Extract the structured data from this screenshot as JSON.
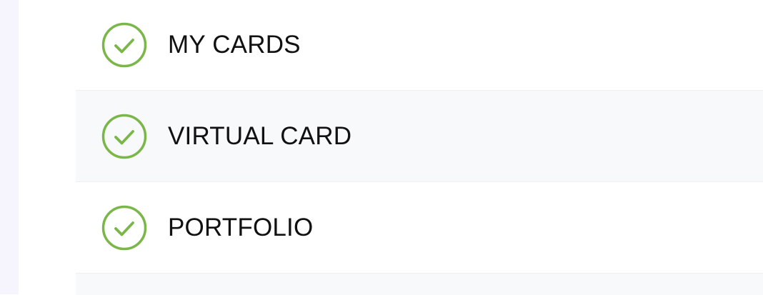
{
  "checklist": {
    "check_color": "#7ab648",
    "items": [
      {
        "label": "MY CARDS",
        "icon": "check-circle-icon"
      },
      {
        "label": "VIRTUAL CARD",
        "icon": "check-circle-icon"
      },
      {
        "label": "PORTFOLIO",
        "icon": "check-circle-icon"
      }
    ]
  }
}
